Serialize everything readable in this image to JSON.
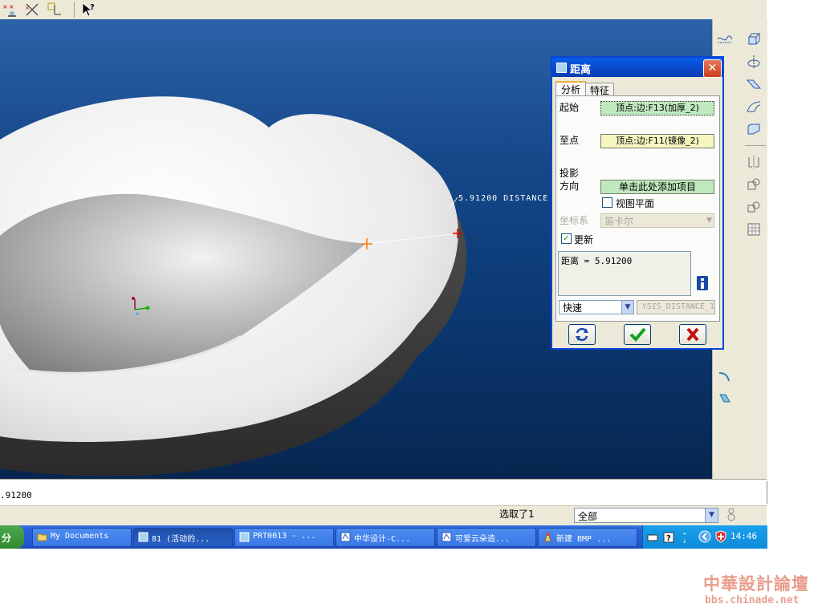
{
  "toolbar": {
    "icons": [
      "datum-point-icon",
      "datum-axis-icon",
      "datum-csys-icon",
      "whats-this-cursor-icon"
    ]
  },
  "graphics": {
    "dimension_label": "5.91200  DISTANCE"
  },
  "right_toolbar": {
    "icons": [
      "datum-plane-display-icon",
      "extrude-icon",
      "revolve-icon",
      "sweep-icon",
      "blend-icon",
      "round-icon",
      "mirror-icon",
      "copy-icon",
      "pattern-icon",
      "shell-icon",
      "rib-icon",
      "draft-icon"
    ]
  },
  "message_line": {
    "text": ".91200"
  },
  "status_bar": {
    "selection_text": "选取了1",
    "filter_value": "全部"
  },
  "taskbar": {
    "start_label": "分",
    "tasks": [
      {
        "label": "My Documents",
        "icon": "folder-icon"
      },
      {
        "label": "81 (活动的...",
        "icon": "proe-window-icon"
      },
      {
        "label": "PRT0013 - ...",
        "icon": "proe-window-icon"
      },
      {
        "label": "中华设计-C...",
        "icon": "browser-icon"
      },
      {
        "label": "可爱云朵造...",
        "icon": "browser-icon"
      },
      {
        "label": "新建 BMP ...",
        "icon": "paint-icon"
      }
    ],
    "clock": "14:46"
  },
  "dialog": {
    "title": "距离",
    "tabs": [
      "分析",
      "特征"
    ],
    "active_tab": "分析",
    "from_label": "起始",
    "from_value": "顶点:边:F13(加厚_2)",
    "to_label": "至点",
    "to_value": "顶点:边:F11(镜像_2)",
    "projection_label_1": "投影",
    "projection_label_2": "方向",
    "projection_value": "单击此处添加项目",
    "view_plane_label": "视图平面",
    "view_plane_checked": false,
    "csys_label": "坐标系",
    "csys_value": "笛卡尔",
    "update_label": "更新",
    "update_checked": true,
    "result_text": "距离 = 5.91200",
    "mode_value": "快速",
    "feature_name": "YSIS_DISTANCE_1",
    "colors": {
      "selected_field": "#bfe8bf",
      "pending_field": "#f6f6c0"
    }
  },
  "watermark": {
    "title": "中華設計論壇",
    "url": "bbs.chinade.net"
  }
}
